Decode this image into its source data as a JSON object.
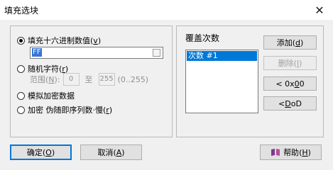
{
  "window": {
    "title": "填充选块",
    "close_glyph": "✕"
  },
  "fill_group": {
    "option_hex": {
      "label": "填充十六进制数值",
      "accel": "v",
      "selected": true
    },
    "hex_value": "FF",
    "option_random": {
      "label": "随机字符",
      "accel": "r",
      "selected": false
    },
    "range": {
      "label": "范围",
      "accel": "N",
      "from": "0",
      "to_label": "至",
      "to": "255",
      "hint": "(0..255)"
    },
    "option_crypto": {
      "label": "模拟加密数据",
      "selected": false
    },
    "option_pseudo": {
      "label": "加密 伪随即序列数·慢",
      "accel": "r",
      "selected": false
    }
  },
  "overwrite_group": {
    "label": "覆盖次数",
    "items": [
      "次数 #1"
    ]
  },
  "side_buttons": {
    "add": {
      "label": "添加",
      "accel": "d"
    },
    "delete": {
      "label": "删除",
      "accel": "I"
    },
    "x00": {
      "label": "< 0x",
      "accel": "0",
      "suffix": "0"
    },
    "dod": {
      "label": "< ",
      "accel": "D",
      "suffix": "oD"
    }
  },
  "bottom_buttons": {
    "ok": {
      "label": "确定",
      "accel": "O"
    },
    "cancel": {
      "label": "取消",
      "accel": "A"
    },
    "help": {
      "label": "帮助",
      "accel": "H"
    }
  },
  "colors": {
    "selection": "#0078d7",
    "disabled_text": "#a0a0a0"
  },
  "icons": {
    "help": "book-icon"
  }
}
